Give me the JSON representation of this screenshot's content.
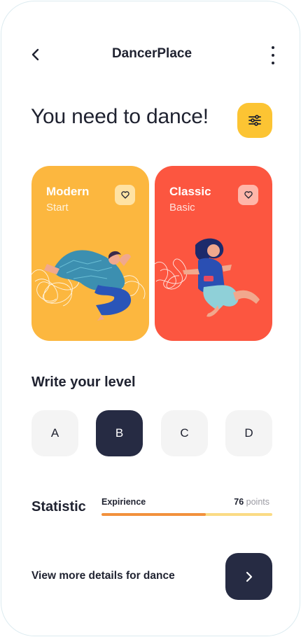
{
  "header": {
    "title": "DancerPlace",
    "back_icon": "chevron-left-icon",
    "menu_icon": "more-vertical-icon"
  },
  "headline": "You need to dance!",
  "filter_icon": "sliders-icon",
  "cards": [
    {
      "title": "Modern",
      "subtitle": "Start",
      "color": "#fcb73f",
      "fav_icon": "heart-icon"
    },
    {
      "title": "Classic",
      "subtitle": "Basic",
      "color": "#fc5640",
      "fav_icon": "heart-icon"
    }
  ],
  "level": {
    "title": "Write your level",
    "options": [
      "A",
      "B",
      "C",
      "D"
    ],
    "selected": "B"
  },
  "statistic": {
    "title": "Statistic",
    "label": "Expirience",
    "value": "76",
    "unit": "points",
    "progress": 0.61
  },
  "footer": {
    "details_text": "View more details for dance",
    "go_icon": "chevron-right-icon"
  },
  "colors": {
    "accent_yellow": "#fcc433",
    "dark": "#262b43",
    "modern_card": "#fcb73f",
    "classic_card": "#fc5640",
    "progress_fill": "#f2913c",
    "progress_track": "#fbdb84"
  }
}
